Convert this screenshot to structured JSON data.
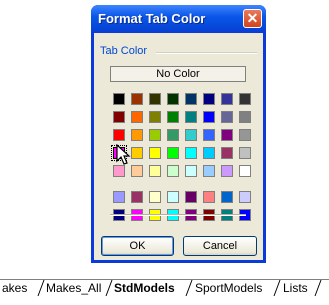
{
  "dialog": {
    "title": "Format Tab Color",
    "close_glyph": "✕",
    "group_label": "Tab Color",
    "no_color_label": "No Color",
    "ok_label": "OK",
    "cancel_label": "Cancel",
    "palette_rows": [
      [
        "#000000",
        "#993300",
        "#333300",
        "#003300",
        "#003366",
        "#000080",
        "#333399",
        "#333333"
      ],
      [
        "#800000",
        "#ff6600",
        "#808000",
        "#008000",
        "#008080",
        "#0000ff",
        "#666699",
        "#808080"
      ],
      [
        "#ff0000",
        "#ff9900",
        "#99cc00",
        "#339966",
        "#33cccc",
        "#3366ff",
        "#800080",
        "#969696"
      ],
      [
        "#ff00ff",
        "#ffcc00",
        "#ffff00",
        "#00ff00",
        "#00ffff",
        "#00ccff",
        "#993366",
        "#c0c0c0"
      ],
      [
        "#ff99cc",
        "#ffcc99",
        "#ffff99",
        "#ccffcc",
        "#ccffff",
        "#99ccff",
        "#cc99ff",
        "#ffffff"
      ]
    ],
    "chart_rows": [
      [
        "#9999ff",
        "#993366",
        "#ffffcc",
        "#ccffff",
        "#660066",
        "#ff8080",
        "#0066cc",
        "#ccccff"
      ],
      [
        "#000080",
        "#ff00ff",
        "#ffff00",
        "#00ffff",
        "#800080",
        "#800000",
        "#008080",
        "#0000ff"
      ]
    ],
    "selected_color": "#ff00ff",
    "cursor_icon": "arrow-cursor-icon"
  },
  "sheet_tabs": [
    "akes",
    "Makes_All",
    "StdModels",
    "SportModels",
    "Lists"
  ],
  "active_tab": "StdModels"
}
